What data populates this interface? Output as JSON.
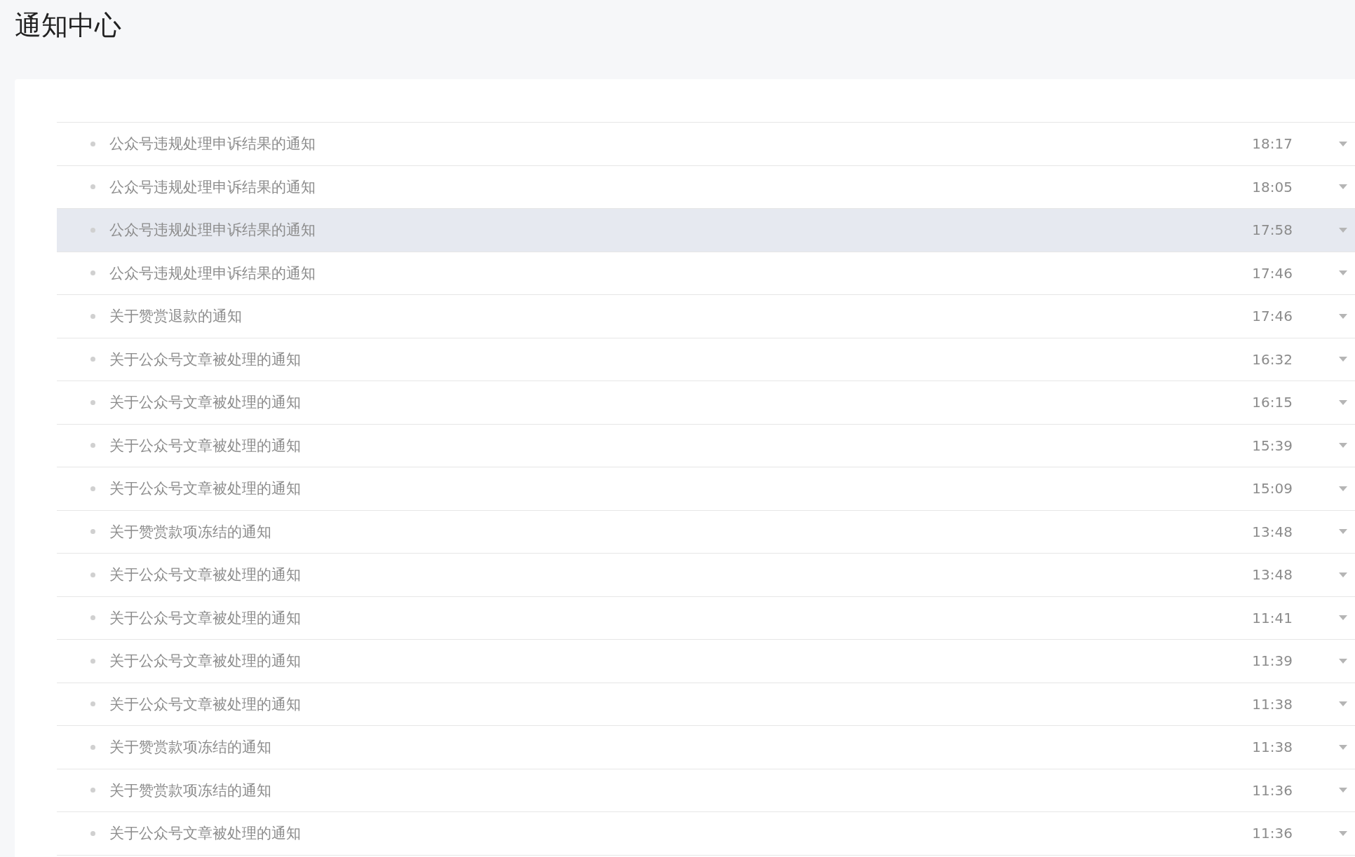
{
  "page_title": "通知中心",
  "notifications": [
    {
      "title": "公众号违规处理申诉结果的通知",
      "time": "18:17",
      "hovered": false
    },
    {
      "title": "公众号违规处理申诉结果的通知",
      "time": "18:05",
      "hovered": false
    },
    {
      "title": "公众号违规处理申诉结果的通知",
      "time": "17:58",
      "hovered": true
    },
    {
      "title": "公众号违规处理申诉结果的通知",
      "time": "17:46",
      "hovered": false
    },
    {
      "title": "关于赞赏退款的通知",
      "time": "17:46",
      "hovered": false
    },
    {
      "title": "关于公众号文章被处理的通知",
      "time": "16:32",
      "hovered": false
    },
    {
      "title": "关于公众号文章被处理的通知",
      "time": "16:15",
      "hovered": false
    },
    {
      "title": "关于公众号文章被处理的通知",
      "time": "15:39",
      "hovered": false
    },
    {
      "title": "关于公众号文章被处理的通知",
      "time": "15:09",
      "hovered": false
    },
    {
      "title": "关于赞赏款项冻结的通知",
      "time": "13:48",
      "hovered": false
    },
    {
      "title": "关于公众号文章被处理的通知",
      "time": "13:48",
      "hovered": false
    },
    {
      "title": "关于公众号文章被处理的通知",
      "time": "11:41",
      "hovered": false
    },
    {
      "title": "关于公众号文章被处理的通知",
      "time": "11:39",
      "hovered": false
    },
    {
      "title": "关于公众号文章被处理的通知",
      "time": "11:38",
      "hovered": false
    },
    {
      "title": "关于赞赏款项冻结的通知",
      "time": "11:38",
      "hovered": false
    },
    {
      "title": "关于赞赏款项冻结的通知",
      "time": "11:36",
      "hovered": false
    },
    {
      "title": "关于公众号文章被处理的通知",
      "time": "11:36",
      "hovered": false
    }
  ]
}
